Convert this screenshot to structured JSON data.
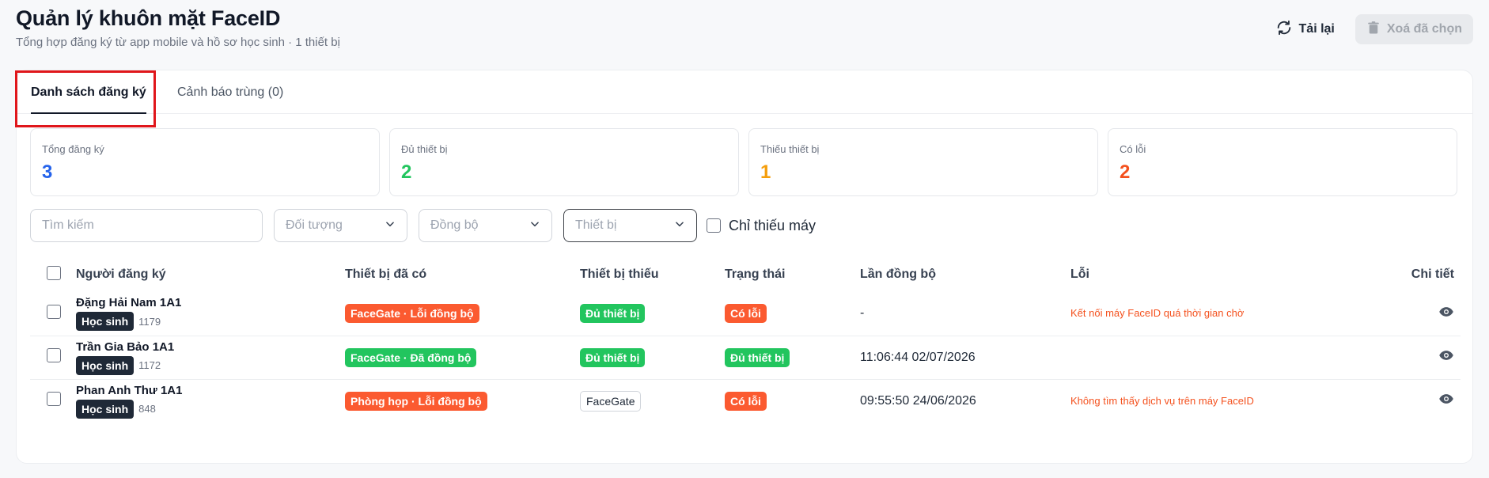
{
  "header": {
    "title": "Quản lý khuôn mặt FaceID",
    "subtitle": "Tổng hợp đăng ký từ app mobile và hồ sơ học sinh · 1 thiết bị",
    "reload_label": "Tải lại",
    "delete_label": "Xoá đã chọn"
  },
  "tabs": [
    {
      "label": "Danh sách đăng ký"
    },
    {
      "label": "Cảnh báo trùng (0)"
    }
  ],
  "stats": [
    {
      "label": "Tổng đăng ký",
      "value": "3",
      "color": "#2563eb"
    },
    {
      "label": "Đủ thiết bị",
      "value": "2",
      "color": "#22c55e"
    },
    {
      "label": "Thiếu thiết bị",
      "value": "1",
      "color": "#f59e0b"
    },
    {
      "label": "Có lỗi",
      "value": "2",
      "color": "#f4511e"
    }
  ],
  "filters": {
    "search_placeholder": "Tìm kiếm",
    "subject_placeholder": "Đối tượng",
    "sync_placeholder": "Đồng bộ",
    "device_placeholder": "Thiết bị",
    "missing_only_label": "Chỉ thiếu máy"
  },
  "table": {
    "headers": {
      "registrant": "Người đăng ký",
      "devices": "Thiết bị đã có",
      "missing": "Thiết bị thiếu",
      "status": "Trạng thái",
      "last_sync": "Lần đồng bộ",
      "error": "Lỗi",
      "detail": "Chi tiết"
    },
    "rows": [
      {
        "name": "Đặng Hải Nam 1A1",
        "role": "Học sinh",
        "id": "1179",
        "devices": "FaceGate · Lỗi đồng bộ",
        "devices_tone": "red",
        "missing": "Đủ thiết bị",
        "missing_tone": "green",
        "status": "Có lỗi",
        "status_tone": "red",
        "last_sync": "-",
        "error": "Kết nối máy FaceID quá thời gian chờ"
      },
      {
        "name": "Trần Gia Bảo 1A1",
        "role": "Học sinh",
        "id": "1172",
        "devices": "FaceGate · Đã đồng bộ",
        "devices_tone": "green",
        "missing": "Đủ thiết bị",
        "missing_tone": "green",
        "status": "Đủ thiết bị",
        "status_tone": "green",
        "last_sync": "11:06:44 02/07/2026",
        "error": ""
      },
      {
        "name": "Phan Anh Thư 1A1",
        "role": "Học sinh",
        "id": "848",
        "devices": "Phòng họp · Lỗi đồng bộ",
        "devices_tone": "red",
        "missing": "FaceGate",
        "missing_tone": "outline",
        "status": "Có lỗi",
        "status_tone": "red",
        "last_sync": "09:55:50 24/06/2026",
        "error": "Không tìm thấy dịch vụ trên máy FaceID"
      }
    ]
  },
  "icons": {
    "reload": "refresh-icon",
    "delete": "trash-icon",
    "dropdown": "chevron-down-icon",
    "detail": "eye-icon"
  }
}
